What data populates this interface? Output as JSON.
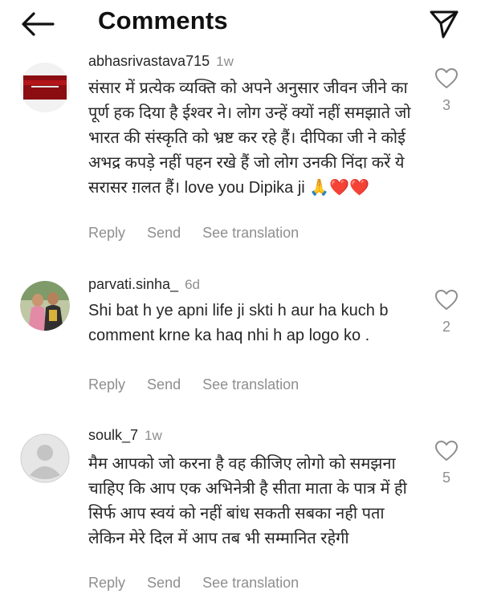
{
  "header": {
    "title": "Comments"
  },
  "comments": [
    {
      "username": "abhasrivastava715",
      "time": "1w",
      "text": "संसार में प्रत्येक व्यक्ति को अपने अनुसार जीवन जीने का पूर्ण हक दिया है ईश्वर ने। लोग उन्हें क्यों नहीं समझाते जो भारत की संस्कृति को भ्रष्ट कर रहे हैं। दीपिका जी ने कोई अभद्र कपड़े नहीं पहन रखे हैं जो लोग उनकी निंदा करें ये सरासर ग़लत हैं। love you Dipika ji 🙏❤️❤️",
      "likes": "3",
      "reply": "Reply",
      "send": "Send",
      "translate": "See translation"
    },
    {
      "username": "parvati.sinha_",
      "time": "6d",
      "text": "Shi bat h ye apni life ji skti h aur ha kuch b comment krne ka haq nhi h ap logo ko .",
      "likes": "2",
      "reply": "Reply",
      "send": "Send",
      "translate": "See translation"
    },
    {
      "username": "soulk_7",
      "time": "1w",
      "text": "मैम आपको जो करना है वह कीजिए लोगो को समझना चाहिए कि आप एक अभिनेत्री है  सीता माता के पात्र में ही सिर्फ आप स्वयं  को  नहीं बांध सकती सबका नही पता लेकिन मेरे दिल में आप तब भी सम्मानित रहेगी",
      "likes": "5",
      "reply": "Reply",
      "send": "Send",
      "translate": "See translation"
    }
  ],
  "colors": {
    "text": "#262626",
    "secondary": "#8e8e8e",
    "background": "#ffffff"
  }
}
